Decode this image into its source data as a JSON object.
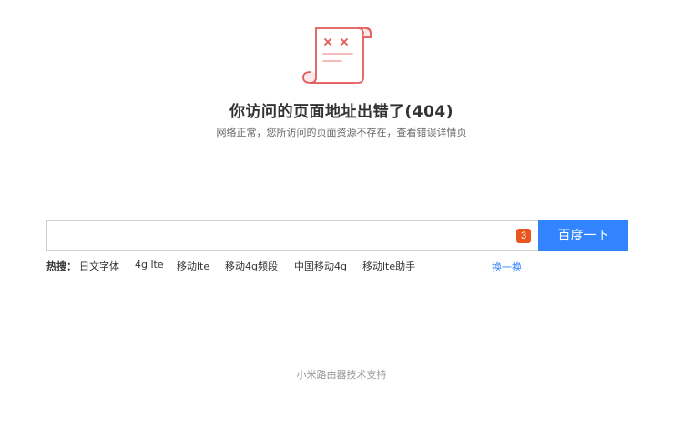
{
  "error": {
    "title": "你访问的页面地址出错了(404)",
    "subtitle": "网络正常，您所访问的页面资源不存在，查看错误详情页"
  },
  "search": {
    "value": "",
    "placeholder": "",
    "badge": "3",
    "button_label": "百度一下"
  },
  "hot": {
    "label": "热搜：",
    "items": [
      "日文字体",
      "4g lte",
      "移动lte",
      "移动4g频段",
      "中国移动4g",
      "移动lte助手"
    ],
    "refresh_label": "换一换"
  },
  "footer": {
    "text": "小米路由器技术支持"
  },
  "colors": {
    "accent": "#3385ff",
    "badge": "#e8551f",
    "illustration": "#e35a5a"
  },
  "icons": {
    "illustration": "error-scroll-icon"
  }
}
